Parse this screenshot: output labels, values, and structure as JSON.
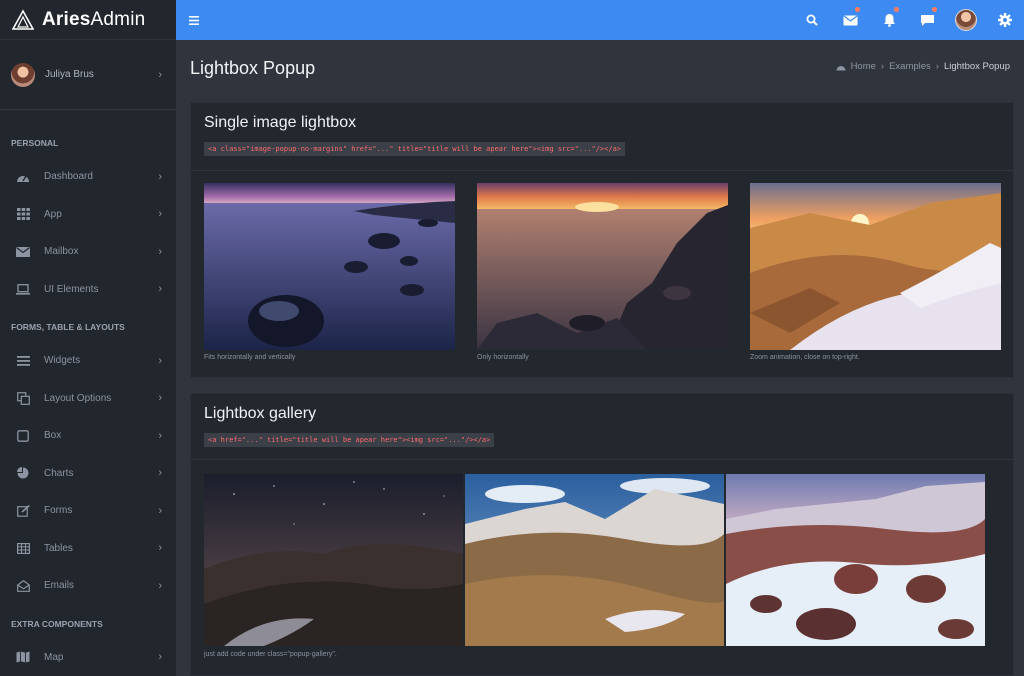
{
  "brand": {
    "bold": "Aries",
    "light": "Admin"
  },
  "header": {
    "icons": [
      "menu-icon",
      "search-icon",
      "mail-icon",
      "bell-icon",
      "chat-icon",
      "avatar",
      "gear-icon"
    ]
  },
  "sidebar": {
    "profile": {
      "name": "Juliya Brus"
    },
    "sections": [
      {
        "title": "PERSONAL",
        "items": [
          {
            "label": "Dashboard",
            "icon": "dashboard-icon"
          },
          {
            "label": "App",
            "icon": "grid-icon"
          },
          {
            "label": "Mailbox",
            "icon": "mail-icon"
          },
          {
            "label": "UI Elements",
            "icon": "laptop-icon"
          }
        ]
      },
      {
        "title": "FORMS, TABLE & LAYOUTS",
        "items": [
          {
            "label": "Widgets",
            "icon": "list-icon"
          },
          {
            "label": "Layout Options",
            "icon": "copy-icon"
          },
          {
            "label": "Box",
            "icon": "square-icon"
          },
          {
            "label": "Charts",
            "icon": "pie-chart-icon"
          },
          {
            "label": "Forms",
            "icon": "edit-icon"
          },
          {
            "label": "Tables",
            "icon": "table-icon"
          },
          {
            "label": "Emails",
            "icon": "envelope-open-icon"
          }
        ]
      },
      {
        "title": "EXTRA COMPONENTS",
        "items": [
          {
            "label": "Map",
            "icon": "map-icon"
          }
        ]
      }
    ]
  },
  "page": {
    "title": "Lightbox Popup",
    "breadcrumb": {
      "home": "Home",
      "middle": "Examples",
      "current": "Lightbox Popup"
    }
  },
  "single": {
    "title": "Single image lightbox",
    "code": "<a class=\"image-popup-no-margins\" href=\"...\" title=\"title will be apear here\"><img src=\"...\"/></a>",
    "captions": [
      "Fits horizontally and vertically",
      "Only horizontally",
      "Zoom animation, close on top-right."
    ]
  },
  "gallery": {
    "title": "Lightbox gallery",
    "code": "<a href=\"...\" title=\"title will be apear here\"><img src=\"...\"/></a>",
    "caption": "just add code under class=\"popup-gallery\"."
  },
  "colors": {
    "accent": "#3d8bf2",
    "sidebar": "#22262d",
    "content": "#30343c",
    "card": "#23272e",
    "code": "#ff6b6b"
  }
}
